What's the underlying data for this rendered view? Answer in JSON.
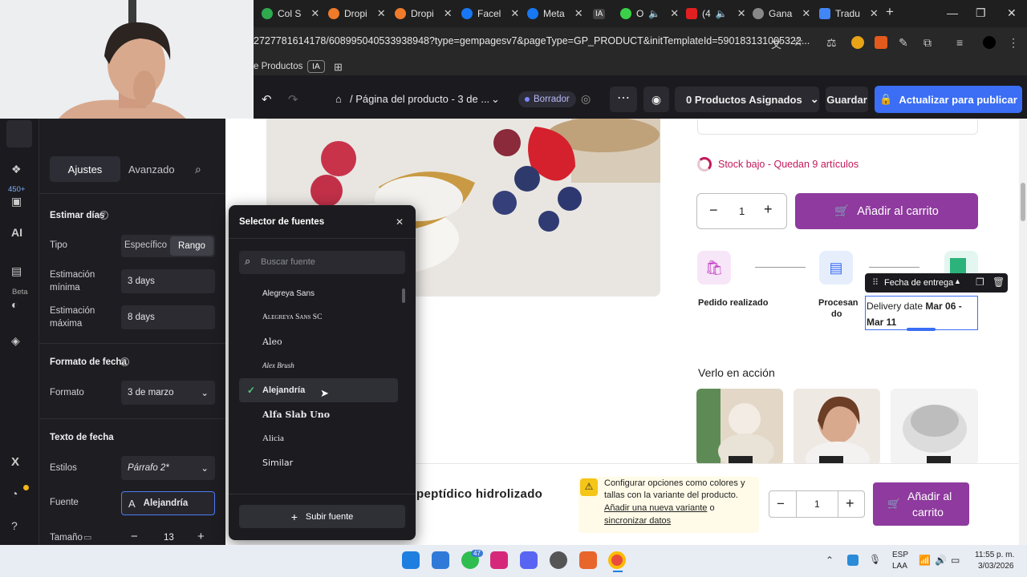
{
  "browser": {
    "tabs": [
      {
        "label": "Col S",
        "color": "#2eaa4f"
      },
      {
        "label": "Dropi",
        "color": "#f07b2a"
      },
      {
        "label": "Dropi",
        "color": "#f07b2a"
      },
      {
        "label": "Facel",
        "color": "#1877f2"
      },
      {
        "label": "Meta",
        "color": "#1877f2"
      },
      {
        "label": "IA",
        "color": "#5a5a5a"
      },
      {
        "label": "O",
        "color": "#3ad04a"
      },
      {
        "label": "(4",
        "color": "#e02020"
      },
      {
        "label": "Gana",
        "color": "#888888"
      },
      {
        "label": "Tradu",
        "color": "#4285f4"
      }
    ],
    "url": "2727781614178/608995040533938948?type=gempagesv7&pageType=GP_PRODUCT&initTemplateId=590183131005322...",
    "bookmarks": {
      "item1": "e Productos",
      "item2": "IA"
    }
  },
  "toolbar": {
    "page_title": "/ Página del producto - 3 de ...",
    "status_badge": "Borrador",
    "assigned": "0 Productos Asignados",
    "save": "Guardar",
    "publish": "Actualizar para publicar"
  },
  "rail": {
    "badge": "450+",
    "beta": "Beta"
  },
  "settings": {
    "tab_settings": "Ajustes",
    "tab_advanced": "Avanzado",
    "estimate_heading": "Estimar días",
    "type_label": "Tipo",
    "type_specific": "Específico",
    "type_range": "Rango",
    "min_label_1": "Estimación",
    "min_label_2": "mínima",
    "min_value": "3 days",
    "max_label_1": "Estimación",
    "max_label_2": "máxima",
    "max_value": "8 days",
    "date_format_heading": "Formato de fecha",
    "format_label": "Formato",
    "format_value": "3 de marzo",
    "date_text_heading": "Texto de fecha",
    "styles_label": "Estilos",
    "styles_value": "Párrafo 2*",
    "font_label": "Fuente",
    "font_value": "Alejandría",
    "size_label": "Tamaño",
    "size_value": "13"
  },
  "font_selector": {
    "title": "Selector de fuentes",
    "search_placeholder": "Buscar fuente",
    "fonts": [
      "Alegreya Sans",
      "Alegreya Sans SC",
      "Aleo",
      "Alex Brush",
      "Alejandría",
      "Alfa Slab Uno",
      "Alicia",
      "Similar"
    ],
    "selected": "Alejandría",
    "upload": "Subir fuente"
  },
  "product": {
    "stock": "Stock bajo - Quedan 9 artículos",
    "qty": "1",
    "add_to_cart": "Añadir al carrito",
    "step1": "Pedido realizado",
    "step2_1": "Procesan",
    "step2_2": "do",
    "delivery_chip": "Fecha de entrega",
    "delivery_prefix": "Delivery date ",
    "delivery_bold1": "Mar 06 -",
    "delivery_bold2": "Mar 11",
    "video_heading": "Verlo en acción"
  },
  "sticky": {
    "title": "peptídico hidrolizado",
    "notice_1": "Configurar opciones como colores y",
    "notice_2": "tallas con la variante del producto.",
    "notice_link1": "Añadir una nueva variante",
    "notice_o": " o",
    "notice_link2": "sincronizar datos",
    "qty": "1",
    "cart_1": "Añadir al",
    "cart_2": "carrito"
  },
  "taskbar": {
    "whatsapp_badge": "47",
    "lang_1": "ESP",
    "lang_2": "LAA",
    "time": "11:55 p. m.",
    "date": "3/03/2026"
  },
  "colors": {
    "accent": "#8e3a9e",
    "primary": "#3b6ef5",
    "stock": "#c2185b"
  }
}
